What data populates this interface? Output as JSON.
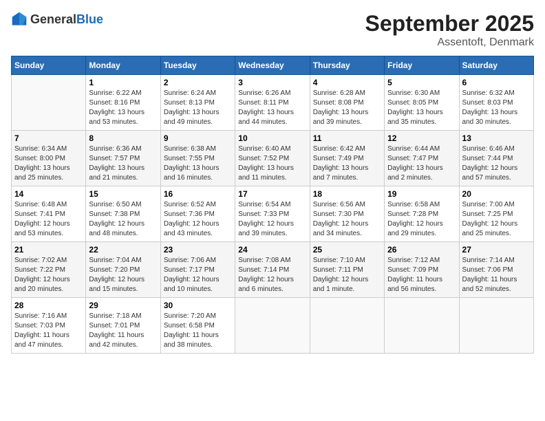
{
  "logo": {
    "text_general": "General",
    "text_blue": "Blue"
  },
  "header": {
    "month": "September 2025",
    "location": "Assentoft, Denmark"
  },
  "weekdays": [
    "Sunday",
    "Monday",
    "Tuesday",
    "Wednesday",
    "Thursday",
    "Friday",
    "Saturday"
  ],
  "weeks": [
    [
      {
        "day": "",
        "info": ""
      },
      {
        "day": "1",
        "info": "Sunrise: 6:22 AM\nSunset: 8:16 PM\nDaylight: 13 hours\nand 53 minutes."
      },
      {
        "day": "2",
        "info": "Sunrise: 6:24 AM\nSunset: 8:13 PM\nDaylight: 13 hours\nand 49 minutes."
      },
      {
        "day": "3",
        "info": "Sunrise: 6:26 AM\nSunset: 8:11 PM\nDaylight: 13 hours\nand 44 minutes."
      },
      {
        "day": "4",
        "info": "Sunrise: 6:28 AM\nSunset: 8:08 PM\nDaylight: 13 hours\nand 39 minutes."
      },
      {
        "day": "5",
        "info": "Sunrise: 6:30 AM\nSunset: 8:05 PM\nDaylight: 13 hours\nand 35 minutes."
      },
      {
        "day": "6",
        "info": "Sunrise: 6:32 AM\nSunset: 8:03 PM\nDaylight: 13 hours\nand 30 minutes."
      }
    ],
    [
      {
        "day": "7",
        "info": "Sunrise: 6:34 AM\nSunset: 8:00 PM\nDaylight: 13 hours\nand 25 minutes."
      },
      {
        "day": "8",
        "info": "Sunrise: 6:36 AM\nSunset: 7:57 PM\nDaylight: 13 hours\nand 21 minutes."
      },
      {
        "day": "9",
        "info": "Sunrise: 6:38 AM\nSunset: 7:55 PM\nDaylight: 13 hours\nand 16 minutes."
      },
      {
        "day": "10",
        "info": "Sunrise: 6:40 AM\nSunset: 7:52 PM\nDaylight: 13 hours\nand 11 minutes."
      },
      {
        "day": "11",
        "info": "Sunrise: 6:42 AM\nSunset: 7:49 PM\nDaylight: 13 hours\nand 7 minutes."
      },
      {
        "day": "12",
        "info": "Sunrise: 6:44 AM\nSunset: 7:47 PM\nDaylight: 13 hours\nand 2 minutes."
      },
      {
        "day": "13",
        "info": "Sunrise: 6:46 AM\nSunset: 7:44 PM\nDaylight: 12 hours\nand 57 minutes."
      }
    ],
    [
      {
        "day": "14",
        "info": "Sunrise: 6:48 AM\nSunset: 7:41 PM\nDaylight: 12 hours\nand 53 minutes."
      },
      {
        "day": "15",
        "info": "Sunrise: 6:50 AM\nSunset: 7:38 PM\nDaylight: 12 hours\nand 48 minutes."
      },
      {
        "day": "16",
        "info": "Sunrise: 6:52 AM\nSunset: 7:36 PM\nDaylight: 12 hours\nand 43 minutes."
      },
      {
        "day": "17",
        "info": "Sunrise: 6:54 AM\nSunset: 7:33 PM\nDaylight: 12 hours\nand 39 minutes."
      },
      {
        "day": "18",
        "info": "Sunrise: 6:56 AM\nSunset: 7:30 PM\nDaylight: 12 hours\nand 34 minutes."
      },
      {
        "day": "19",
        "info": "Sunrise: 6:58 AM\nSunset: 7:28 PM\nDaylight: 12 hours\nand 29 minutes."
      },
      {
        "day": "20",
        "info": "Sunrise: 7:00 AM\nSunset: 7:25 PM\nDaylight: 12 hours\nand 25 minutes."
      }
    ],
    [
      {
        "day": "21",
        "info": "Sunrise: 7:02 AM\nSunset: 7:22 PM\nDaylight: 12 hours\nand 20 minutes."
      },
      {
        "day": "22",
        "info": "Sunrise: 7:04 AM\nSunset: 7:20 PM\nDaylight: 12 hours\nand 15 minutes."
      },
      {
        "day": "23",
        "info": "Sunrise: 7:06 AM\nSunset: 7:17 PM\nDaylight: 12 hours\nand 10 minutes."
      },
      {
        "day": "24",
        "info": "Sunrise: 7:08 AM\nSunset: 7:14 PM\nDaylight: 12 hours\nand 6 minutes."
      },
      {
        "day": "25",
        "info": "Sunrise: 7:10 AM\nSunset: 7:11 PM\nDaylight: 12 hours\nand 1 minute."
      },
      {
        "day": "26",
        "info": "Sunrise: 7:12 AM\nSunset: 7:09 PM\nDaylight: 11 hours\nand 56 minutes."
      },
      {
        "day": "27",
        "info": "Sunrise: 7:14 AM\nSunset: 7:06 PM\nDaylight: 11 hours\nand 52 minutes."
      }
    ],
    [
      {
        "day": "28",
        "info": "Sunrise: 7:16 AM\nSunset: 7:03 PM\nDaylight: 11 hours\nand 47 minutes."
      },
      {
        "day": "29",
        "info": "Sunrise: 7:18 AM\nSunset: 7:01 PM\nDaylight: 11 hours\nand 42 minutes."
      },
      {
        "day": "30",
        "info": "Sunrise: 7:20 AM\nSunset: 6:58 PM\nDaylight: 11 hours\nand 38 minutes."
      },
      {
        "day": "",
        "info": ""
      },
      {
        "day": "",
        "info": ""
      },
      {
        "day": "",
        "info": ""
      },
      {
        "day": "",
        "info": ""
      }
    ]
  ]
}
